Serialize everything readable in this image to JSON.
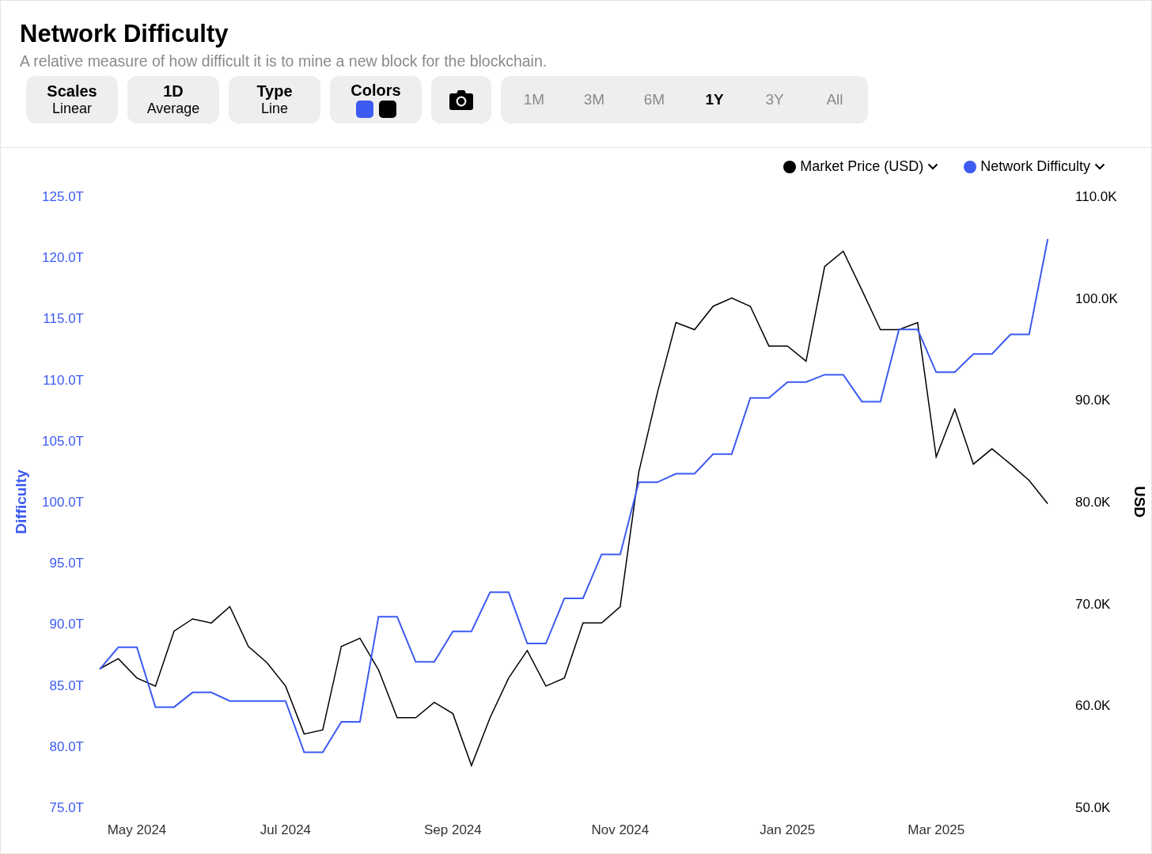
{
  "header": {
    "title": "Network Difficulty",
    "subtitle": "A relative measure of how difficult it is to mine a new block for the blockchain."
  },
  "controls": [
    {
      "kind": "option",
      "title": "Scales",
      "value": "Linear"
    },
    {
      "kind": "option",
      "title": "1D",
      "value": "Average"
    },
    {
      "kind": "option",
      "title": "Type",
      "value": "Line"
    },
    {
      "kind": "colors",
      "title": "Colors",
      "swatches": [
        {
          "color": "#3d5af1"
        },
        {
          "color": "#000000"
        }
      ]
    },
    {
      "kind": "camera"
    }
  ],
  "ranges": [
    {
      "label": "1M",
      "selected": false
    },
    {
      "label": "3M",
      "selected": false
    },
    {
      "label": "6M",
      "selected": false
    },
    {
      "label": "1Y",
      "selected": true
    },
    {
      "label": "3Y",
      "selected": false
    },
    {
      "label": "All",
      "selected": false
    }
  ],
  "chart": {
    "chart_data": {
      "type": "line",
      "ylabel": "Difficulty",
      "y2label": "USD",
      "categories": [
        null,
        null,
        "May 2024",
        null,
        null,
        null,
        null,
        null,
        null,
        null,
        "Jul 2024",
        null,
        null,
        null,
        null,
        null,
        null,
        null,
        null,
        "Sep 2024",
        null,
        null,
        null,
        null,
        null,
        null,
        null,
        null,
        "Nov 2024",
        null,
        null,
        null,
        null,
        null,
        null,
        null,
        null,
        "Jan 2025",
        null,
        null,
        null,
        null,
        null,
        null,
        null,
        "Mar 2025",
        null,
        null,
        null,
        null,
        null,
        null
      ],
      "ylim": [
        75,
        125
      ],
      "yticks": [
        {
          "value": 125,
          "label": "125.0T"
        },
        {
          "value": 120,
          "label": "120.0T"
        },
        {
          "value": 115,
          "label": "115.0T"
        },
        {
          "value": 110,
          "label": "110.0T"
        },
        {
          "value": 105,
          "label": "105.0T"
        },
        {
          "value": 100,
          "label": "100.0T"
        },
        {
          "value": 95,
          "label": "95.0T"
        },
        {
          "value": 90,
          "label": "90.0T"
        },
        {
          "value": 85,
          "label": "85.0T"
        },
        {
          "value": 80,
          "label": "80.0T"
        },
        {
          "value": 75,
          "label": "75.0T"
        }
      ],
      "y2lim": [
        50,
        110
      ],
      "y2ticks": [
        {
          "value": 110,
          "label": "110.0K"
        },
        {
          "value": 100,
          "label": "100.0K"
        },
        {
          "value": 90,
          "label": "90.0K"
        },
        {
          "value": 80,
          "label": "80.0K"
        },
        {
          "value": 70,
          "label": "70.0K"
        },
        {
          "value": 60,
          "label": "60.0K"
        },
        {
          "value": 50,
          "label": "50.0K"
        }
      ],
      "series": [
        {
          "name": "Market Price (USD)",
          "color": "#000000",
          "axis": "y2",
          "values": [
            63.6,
            64.6,
            62.7,
            61.9,
            67.3,
            68.5,
            68.1,
            69.7,
            65.8,
            64.2,
            61.9,
            57.2,
            57.6,
            65.8,
            66.6,
            63.5,
            58.8,
            58.8,
            60.3,
            59.2,
            54.1,
            58.8,
            62.7,
            65.4,
            61.9,
            62.7,
            68.1,
            68.1,
            69.7,
            82.9,
            90.7,
            97.6,
            96.9,
            99.2,
            100.0,
            99.2,
            95.3,
            95.3,
            93.8,
            103.1,
            104.6,
            100.8,
            96.9,
            96.9,
            97.6,
            84.4,
            89.1,
            83.7,
            85.2,
            83.7,
            82.1,
            79.8
          ]
        },
        {
          "name": "Network Difficulty",
          "color": "#3d5af1",
          "values": [
            86.3,
            88.1,
            88.1,
            83.2,
            83.2,
            84.4,
            84.4,
            83.7,
            83.7,
            83.7,
            83.7,
            79.5,
            79.5,
            82.0,
            82.0,
            90.6,
            90.6,
            86.9,
            86.9,
            89.4,
            89.4,
            92.6,
            92.6,
            88.4,
            88.4,
            92.1,
            92.1,
            95.7,
            95.7,
            101.6,
            101.6,
            102.3,
            102.3,
            103.9,
            103.9,
            108.5,
            108.5,
            109.8,
            109.8,
            110.4,
            110.4,
            108.2,
            108.2,
            114.1,
            114.1,
            110.6,
            110.6,
            112.1,
            112.1,
            113.7,
            113.7,
            121.5
          ]
        }
      ]
    }
  }
}
